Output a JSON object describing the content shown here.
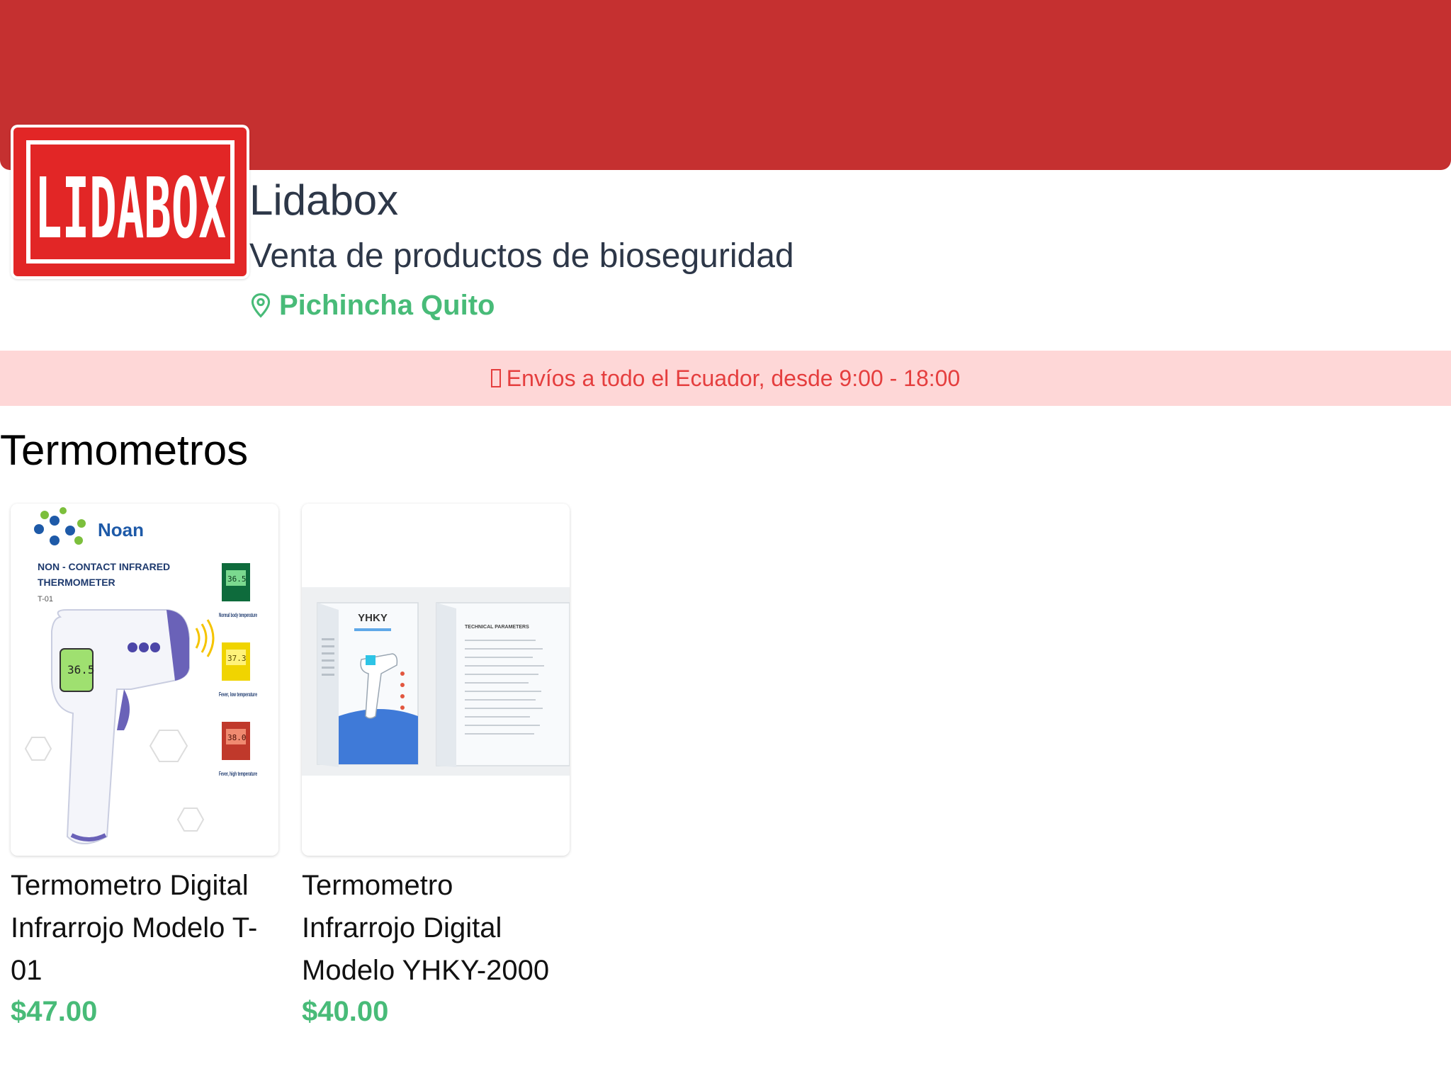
{
  "store": {
    "logo_text": "LIDABOX",
    "name": "Lidabox",
    "description": "Venta de productos de bioseguridad",
    "location": "Pichincha Quito",
    "location_icon": "map-pin-icon"
  },
  "banner": {
    "icon": "truck-icon",
    "text": "Envíos a todo el Ecuador, desde 9:00 - 18:00"
  },
  "section": {
    "title": "Termometros"
  },
  "products": [
    {
      "title": "Termometro Digital Infrarrojo Modelo T-01",
      "price": "$47.00",
      "image_brand": "Noan",
      "image_heading_1": "NON - CONTACT INFRARED",
      "image_heading_2": "THERMOMETER",
      "image_model": "T-01",
      "image_readings": [
        "36.5",
        "37.3",
        "38.0"
      ],
      "image_captions": [
        "Normal body temperature",
        "Fever, low temperature",
        "Fever, high temperature"
      ]
    },
    {
      "title": "Termometro Infrarrojo Digital Modelo YHKY-2000",
      "price": "$40.00",
      "image_brand": "YHKY",
      "image_side_label": "TECHNICAL PARAMETERS"
    }
  ],
  "colors": {
    "brand_red": "#c53030",
    "logo_red": "#e22626",
    "accent_green": "#48bb78",
    "banner_bg": "#fed7d7",
    "banner_text": "#e53e3e"
  }
}
